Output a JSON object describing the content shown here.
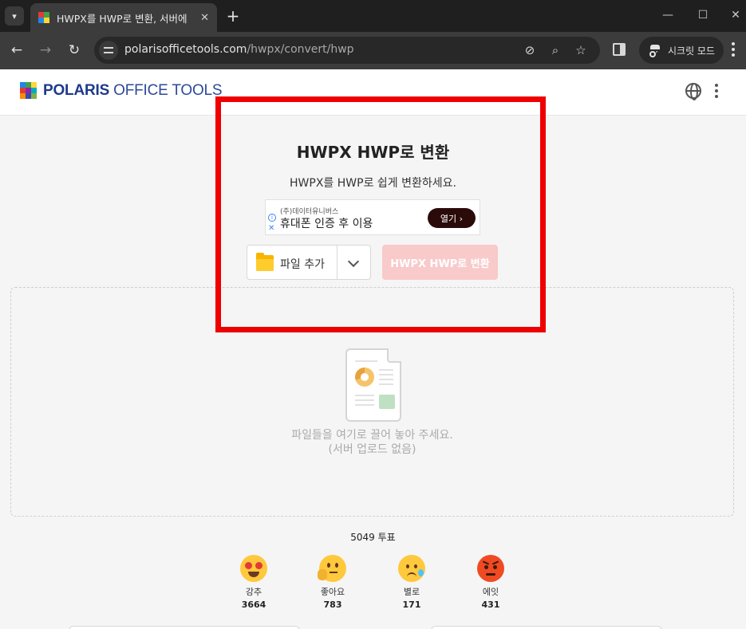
{
  "browser": {
    "tab_title": "HWPX를 HWP로 변환, 서버에",
    "tab_close": "✕",
    "new_tab": "+",
    "url_host": "polarisofficetools.com",
    "url_path": "/hwpx/convert/hwp",
    "incognito_label": "시크릿 모드",
    "minimize": "—",
    "maximize": "☐",
    "close": "✕"
  },
  "header": {
    "logo_strong": "POLARIS",
    "logo_light": " OFFICE TOOLS"
  },
  "main": {
    "title": "HWPX HWP로 변환",
    "subtitle": "HWPX를 HWP로 쉽게 변환하세요.",
    "ad": {
      "advertiser": "(주)데이터유니버스",
      "headline": "휴대폰 인증 후 이용",
      "cta": "열기 ›"
    },
    "add_file_label": "파일 추가",
    "convert_label": "HWPX HWP로 변환",
    "drop_text_1": "파일들을 여기로 끌어 놓아 주세요.",
    "drop_text_2": "(서버 업로드 없음)"
  },
  "votes": {
    "total_label": "5049 투표",
    "reactions": [
      {
        "label": "강추",
        "count": "3664",
        "icon": "heart-eyes-emoji"
      },
      {
        "label": "좋아요",
        "count": "783",
        "icon": "thinking-emoji"
      },
      {
        "label": "별로",
        "count": "171",
        "icon": "sad-emoji"
      },
      {
        "label": "에잇",
        "count": "431",
        "icon": "angry-emoji"
      }
    ]
  },
  "colors": {
    "accent_red": "#ee0000",
    "convert_disabled": "#f8caca",
    "logo_blue": "#1e3a8a"
  }
}
